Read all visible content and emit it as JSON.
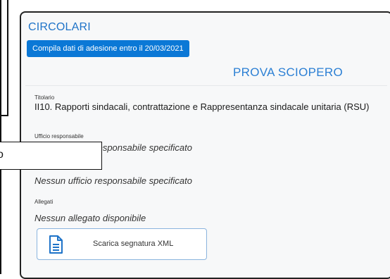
{
  "header": {
    "section_title": "CIRCOLARI",
    "deadline_button": "Compila dati di adesione entro il 20/03/2021"
  },
  "document": {
    "title": "PROVA SCIOPERO",
    "fields": [
      {
        "label": "Titolario",
        "value": "II10. Rapporti sindacali, contrattazione e Rappresentanza sindacale unitaria (RSU)"
      },
      {
        "label": "Ufficio responsabile",
        "value": "Nessun ufficio responsabile specificato"
      },
      {
        "label": "",
        "value": "Nessun ufficio responsabile specificato"
      },
      {
        "label": "Allegati",
        "value": "Nessun allegato disponibile"
      }
    ],
    "xml_button": "Scarica segnatura XML"
  },
  "popup": {
    "text": "o"
  },
  "icons": {
    "xml_button_icon": "document-icon"
  },
  "colors": {
    "accent": "#0b78d6",
    "title": "#2b7fd4",
    "border": "#8ab4de"
  }
}
